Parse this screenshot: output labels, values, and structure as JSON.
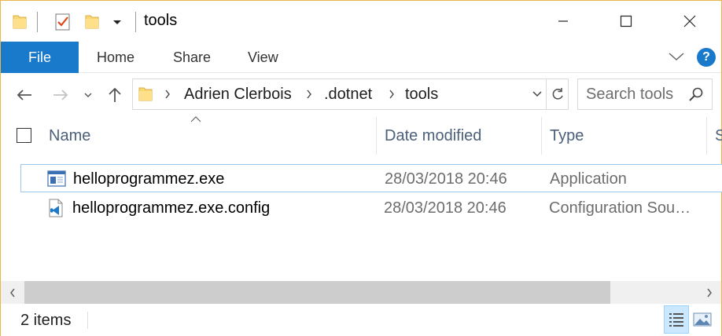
{
  "window": {
    "title": "tools"
  },
  "quick_access": {
    "icons": [
      "folder-icon",
      "properties-icon",
      "new-folder-icon",
      "customize-dropdown-icon"
    ]
  },
  "window_controls": {
    "minimize": "minimize",
    "maximize": "maximize",
    "close": "close"
  },
  "ribbon": {
    "tabs": [
      {
        "label": "File"
      },
      {
        "label": "Home"
      },
      {
        "label": "Share"
      },
      {
        "label": "View"
      }
    ],
    "help_label": "?"
  },
  "address_bar": {
    "breadcrumbs": [
      "Adrien Clerbois",
      ".dotnet",
      "tools"
    ]
  },
  "search": {
    "placeholder": "Search tools"
  },
  "columns": [
    {
      "label": "Name"
    },
    {
      "label": "Date modified"
    },
    {
      "label": "Type"
    },
    {
      "label": "S"
    }
  ],
  "files": [
    {
      "name": "helloprogrammez.exe",
      "date": "28/03/2018 20:46",
      "type": "Application",
      "icon": "application-icon"
    },
    {
      "name": "helloprogrammez.exe.config",
      "date": "28/03/2018 20:46",
      "type": "Configuration Sou…",
      "icon": "vscode-config-icon"
    }
  ],
  "status_bar": {
    "items_text": "2 items"
  },
  "colors": {
    "accent": "#1979ca",
    "window_border": "#e8b64a",
    "selection_border": "#99c9ef",
    "header_text": "#4c607a"
  }
}
